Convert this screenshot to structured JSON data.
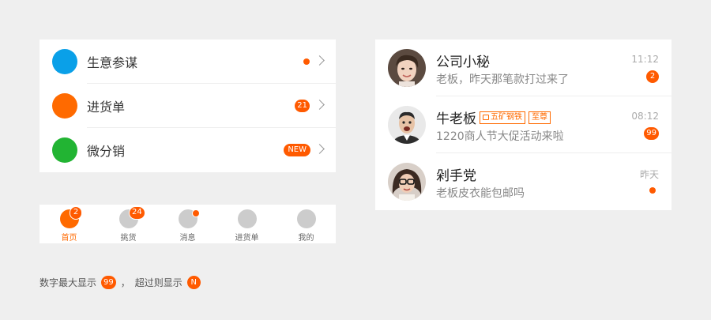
{
  "menu": {
    "items": [
      {
        "label": "生意参谋",
        "icon_color": "#0aa0e8"
      },
      {
        "label": "进货单",
        "icon_color": "#ff6a00",
        "badge": "21"
      },
      {
        "label": "微分销",
        "icon_color": "#22b433",
        "badge": "NEW"
      }
    ]
  },
  "tabbar": {
    "tabs": [
      {
        "label": "首页",
        "badge": "2"
      },
      {
        "label": "挑货",
        "badge": "24"
      },
      {
        "label": "消息"
      },
      {
        "label": "进货单"
      },
      {
        "label": "我的"
      }
    ]
  },
  "note": {
    "part1": "数字最大显示",
    "max_badge": "99",
    "separator": "，",
    "part2": "超过则显示",
    "overflow_badge": "N"
  },
  "messages": [
    {
      "name": "公司小秘",
      "preview": "老板，昨天那笔款打过来了",
      "time": "11:12",
      "badge": "2"
    },
    {
      "name": "牛老板",
      "tags": [
        "五矿钢铁",
        "至尊"
      ],
      "preview": "1220商人节大促活动来啦",
      "time": "08:12",
      "badge": "99"
    },
    {
      "name": "剁手党",
      "preview": "老板皮衣能包邮吗",
      "time": "昨天"
    }
  ],
  "colors": {
    "accent": "#ff6a00",
    "badge": "#ff5a00",
    "inactive": "#cccccc"
  }
}
